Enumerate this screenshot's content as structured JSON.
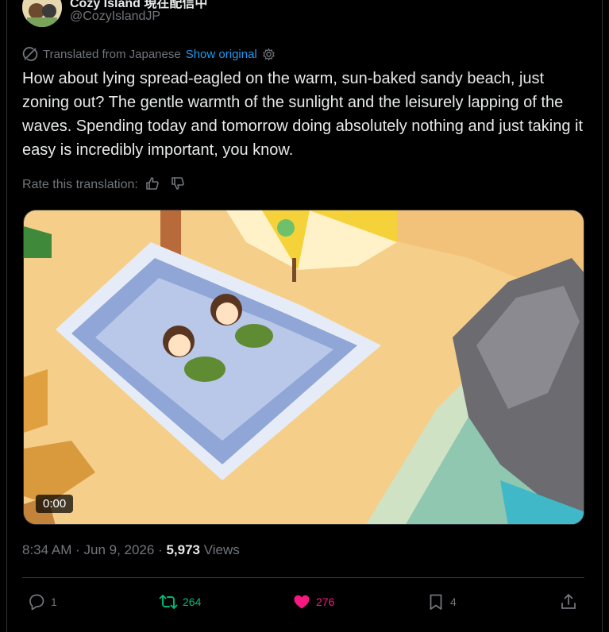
{
  "author": {
    "display_name": "Cozy Island 現在配信中",
    "handle": "@CozyIslandJP"
  },
  "translation": {
    "label": "Translated from Japanese",
    "show_original": "Show original",
    "rate_label": "Rate this translation:"
  },
  "tweet": {
    "text": "How about lying spread-eagled on the warm, sun-baked sandy beach, just zoning out? The gentle warmth of the sunlight and the leisurely lapping of the waves. Spending today and tomorrow doing absolutely nothing and just taking it easy is incredibly important, you know."
  },
  "media": {
    "video_time": "0:00"
  },
  "meta": {
    "time": "8:34 AM",
    "separator": " · ",
    "date": "Jun 9, 2026",
    "views_count": "5,973",
    "views_label": " Views"
  },
  "actions": {
    "replies": "1",
    "reposts": "264",
    "likes": "276",
    "bookmarks": "4"
  },
  "colors": {
    "accent": "#1d9bf0",
    "repost": "#00ba7c",
    "like": "#f91880",
    "muted": "#71767b"
  }
}
